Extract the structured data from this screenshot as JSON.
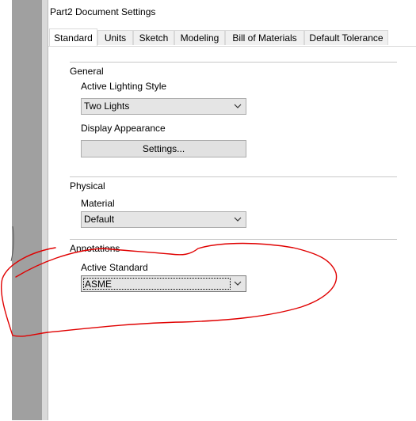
{
  "window": {
    "title": "Part2 Document Settings"
  },
  "tabs": [
    {
      "label": "Standard",
      "active": true
    },
    {
      "label": "Units"
    },
    {
      "label": "Sketch"
    },
    {
      "label": "Modeling"
    },
    {
      "label": "Bill of Materials"
    },
    {
      "label": "Default Tolerance"
    }
  ],
  "general": {
    "title": "General",
    "lighting_label": "Active Lighting Style",
    "lighting_value": "Two Lights",
    "appearance_label": "Display Appearance",
    "settings_button": "Settings..."
  },
  "physical": {
    "title": "Physical",
    "material_label": "Material",
    "material_value": "Default"
  },
  "annotations": {
    "title": "Annotations",
    "standard_label": "Active Standard",
    "standard_value": "ASME"
  },
  "colors": {
    "annotation_stroke": "#e00000",
    "left_bar": "#a0a0a0"
  }
}
